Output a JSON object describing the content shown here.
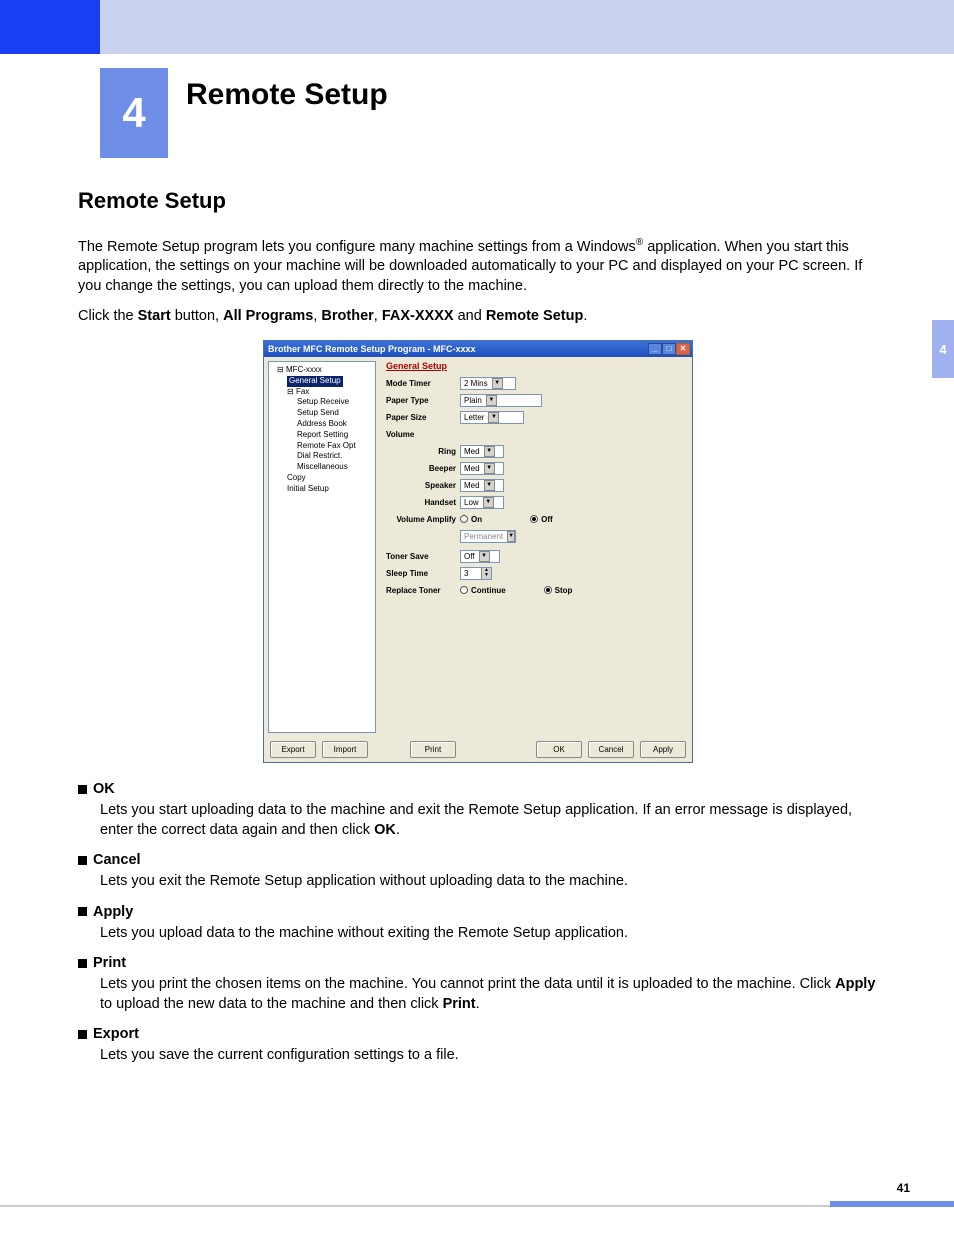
{
  "chapter": {
    "number": "4",
    "title": "Remote Setup"
  },
  "section_title": "Remote Setup",
  "intro_para": "The Remote Setup program lets you configure many machine settings from a Windows",
  "intro_para_after_sup": " application. When you start this application, the settings on your machine will be downloaded automatically to your PC and displayed on your PC screen. If you change the settings, you can upload them directly to the machine.",
  "sup": "®",
  "path_line": {
    "prefix": "Click the ",
    "b1": "Start",
    "mid1": " button, ",
    "b2": "All Programs",
    "mid2": ", ",
    "b3": "Brother",
    "mid3": ", ",
    "b4": "FAX-XXXX",
    "mid4": " and ",
    "b5": "Remote Setup",
    "suffix": "."
  },
  "window": {
    "title": "Brother MFC Remote Setup Program - MFC-xxxx",
    "tree": {
      "root": "MFC-xxxx",
      "selected": "General Setup",
      "items": [
        "Fax",
        "Setup Receive",
        "Setup Send",
        "Address Book",
        "Report Setting",
        "Remote Fax Opt",
        "Dial Restrict.",
        "Miscellaneous",
        "Copy",
        "Initial Setup"
      ]
    },
    "panel_title": "General Setup",
    "fields": {
      "mode_timer": {
        "label": "Mode Timer",
        "value": "2 Mins"
      },
      "paper_type": {
        "label": "Paper Type",
        "value": "Plain"
      },
      "paper_size": {
        "label": "Paper Size",
        "value": "Letter"
      },
      "volume_label": "Volume",
      "ring": {
        "label": "Ring",
        "value": "Med"
      },
      "beeper": {
        "label": "Beeper",
        "value": "Med"
      },
      "speaker": {
        "label": "Speaker",
        "value": "Med"
      },
      "handset": {
        "label": "Handset",
        "value": "Low"
      },
      "amplify": {
        "label": "Volume Amplify",
        "on": "On",
        "off": "Off",
        "selected": "Off"
      },
      "amplify_mode": {
        "value": "Permanent"
      },
      "toner_save": {
        "label": "Toner Save",
        "value": "Off"
      },
      "sleep_time": {
        "label": "Sleep Time",
        "value": "3"
      },
      "replace_toner": {
        "label": "Replace Toner",
        "continue": "Continue",
        "stop": "Stop",
        "selected": "Stop"
      }
    },
    "buttons": {
      "export": "Export",
      "import": "Import",
      "print": "Print",
      "ok": "OK",
      "cancel": "Cancel",
      "apply": "Apply"
    }
  },
  "defs": [
    {
      "term": "OK",
      "desc_pre": "Lets you start uploading data to the machine and exit the Remote Setup application. If an error message is displayed, enter the correct data again and then click ",
      "bold": "OK",
      "desc_post": "."
    },
    {
      "term": "Cancel",
      "desc_pre": "Lets you exit the Remote Setup application without uploading data to the machine.",
      "bold": "",
      "desc_post": ""
    },
    {
      "term": "Apply",
      "desc_pre": "Lets you upload data to the machine without exiting the Remote Setup application.",
      "bold": "",
      "desc_post": ""
    },
    {
      "term": "Print",
      "desc_pre": "Lets you print the chosen items on the machine. You cannot print the data until it is uploaded to the machine. Click ",
      "bold": "Apply",
      "desc_post": " to upload the new data to the machine and then click ",
      "bold2": "Print",
      "desc_post2": "."
    },
    {
      "term": "Export",
      "desc_pre": "Lets you save the current configuration settings to a file.",
      "bold": "",
      "desc_post": ""
    }
  ],
  "side_tab": "4",
  "page_number": "41"
}
